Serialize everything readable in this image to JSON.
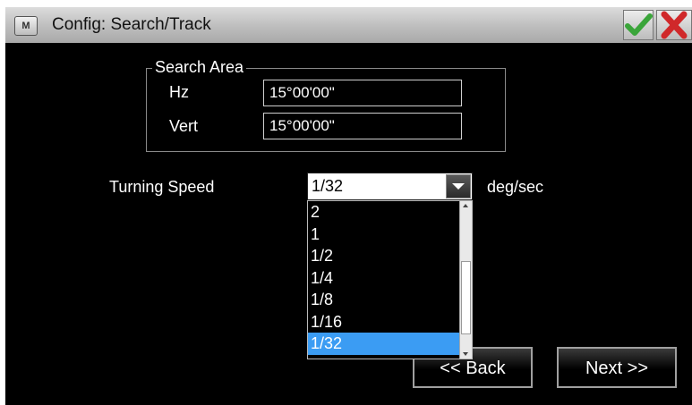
{
  "window": {
    "app_icon_text": "M",
    "title": "Config: Search/Track",
    "ok_icon": "check-icon",
    "cancel_icon": "close-icon",
    "ok_color": "#3aa53a",
    "cancel_color": "#d0282a"
  },
  "search_area": {
    "group_label": "Search Area",
    "hz_label": "Hz",
    "hz_value": "15°00'00\"",
    "vert_label": "Vert",
    "vert_value": "15°00'00\""
  },
  "turning_speed": {
    "label": "Turning Speed",
    "selected": "1/32",
    "unit": "deg/sec",
    "options": [
      "2",
      "1",
      "1/2",
      "1/4",
      "1/8",
      "1/16",
      "1/32"
    ],
    "highlight_color": "#3b9cf3"
  },
  "buttons": {
    "back": "<< Back",
    "next": "Next >>"
  }
}
